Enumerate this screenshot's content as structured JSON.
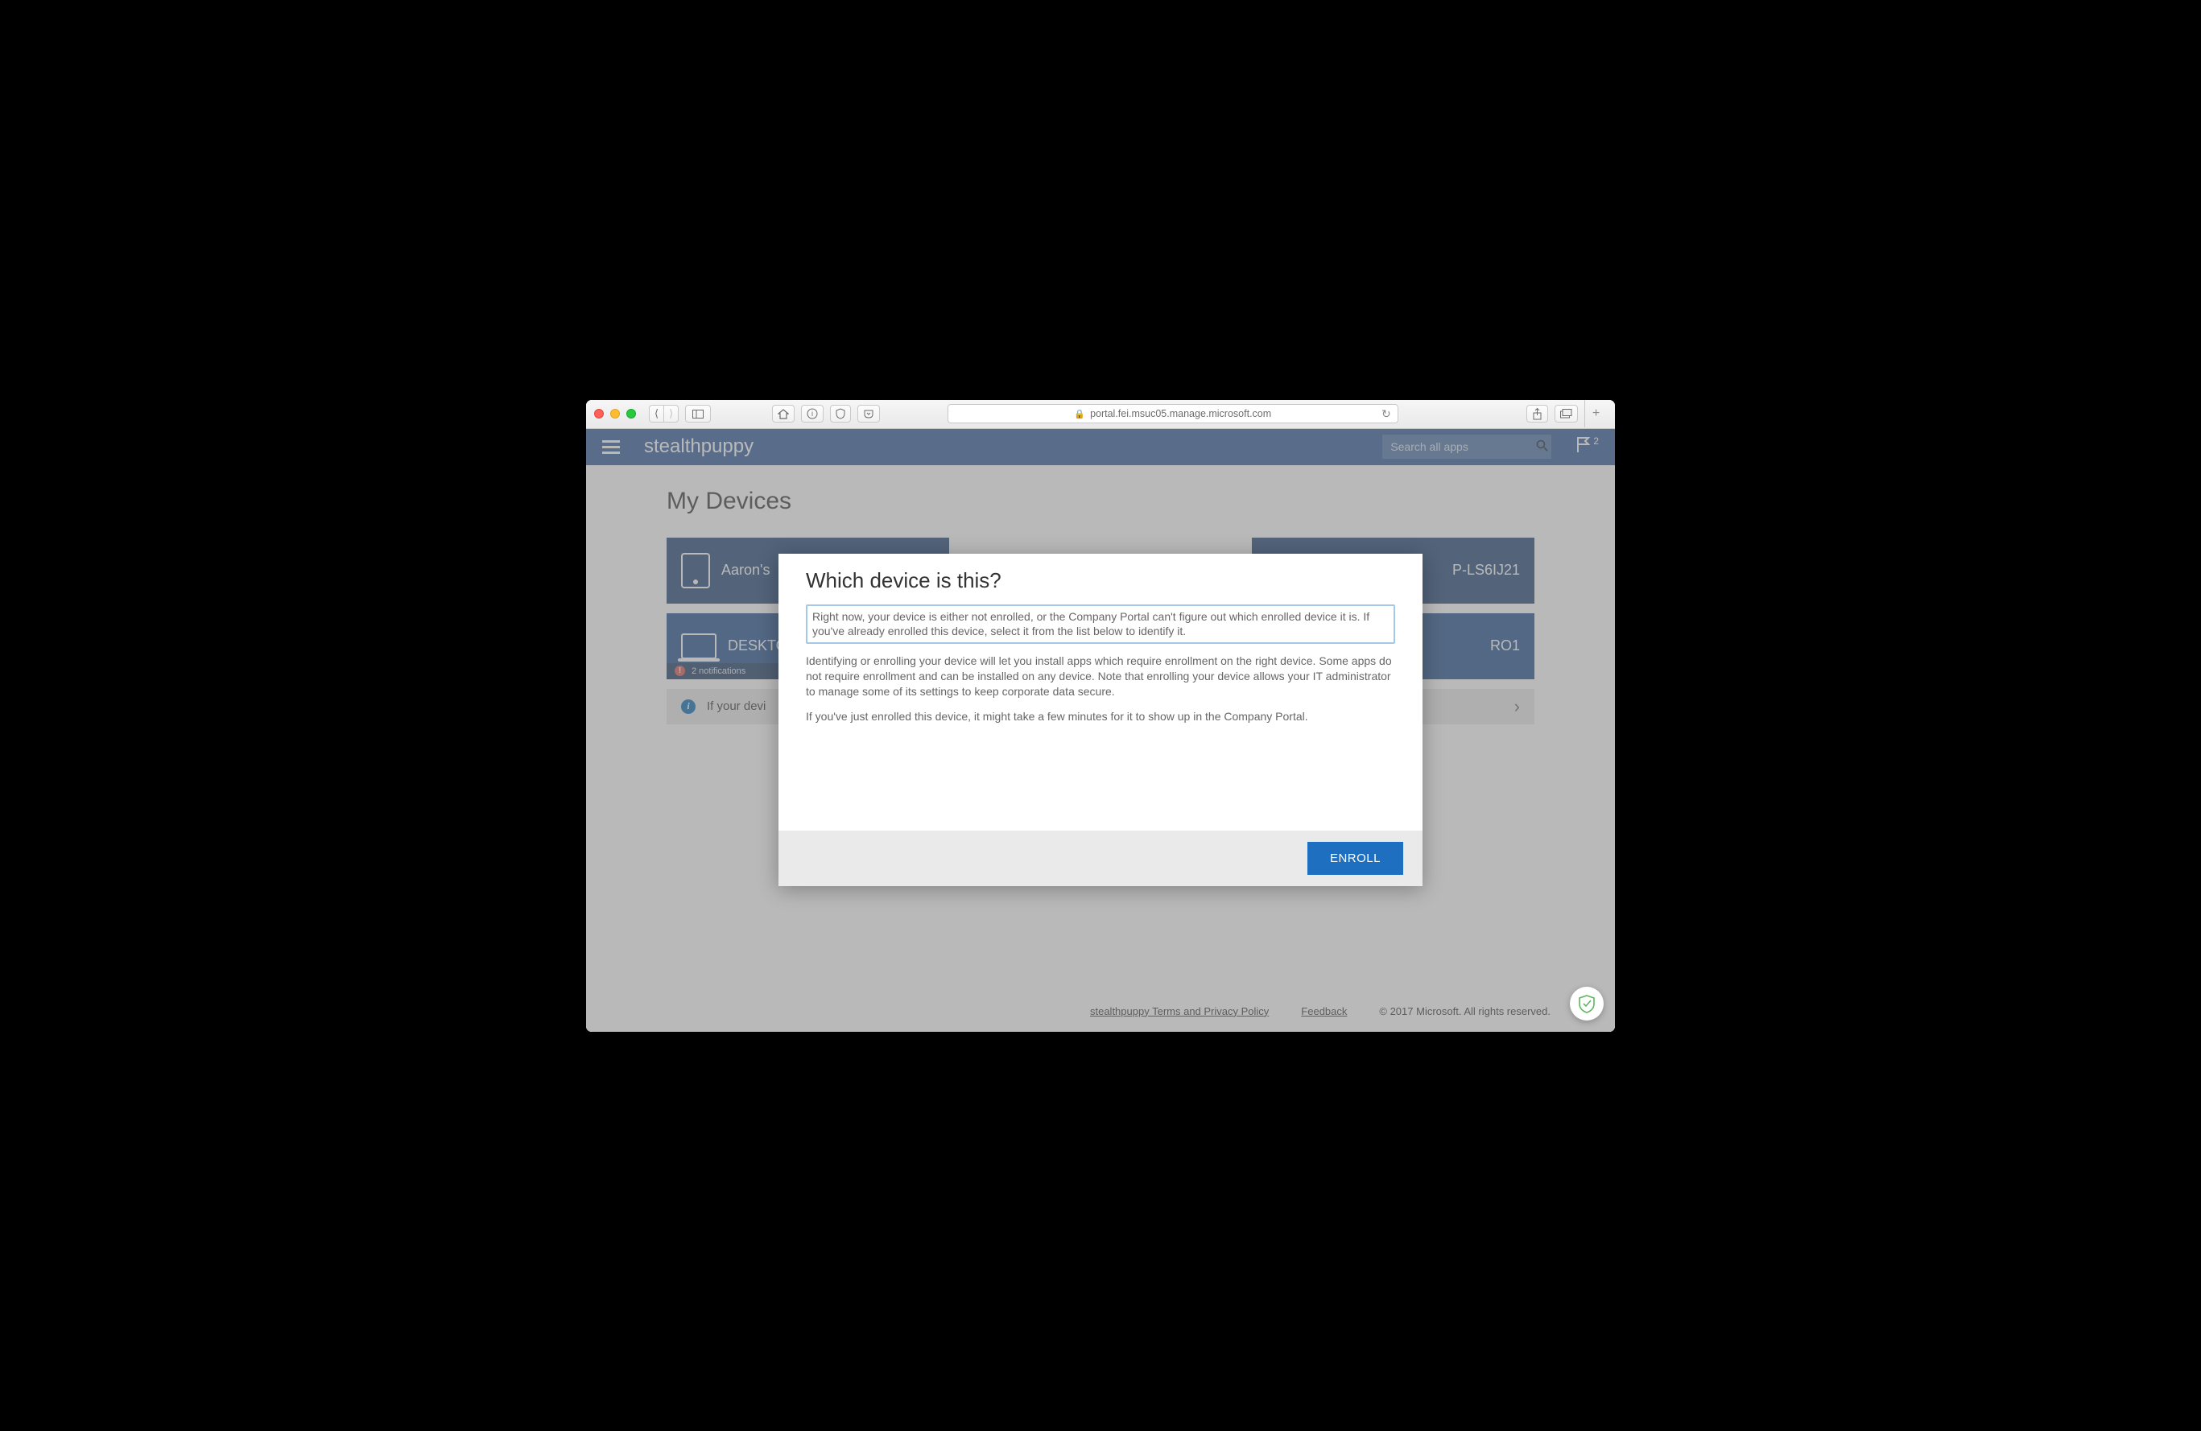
{
  "browser": {
    "url_display": "portal.fei.msuc05.manage.microsoft.com"
  },
  "header": {
    "brand": "stealthpuppy",
    "search_placeholder": "Search all apps",
    "notification_count": "2"
  },
  "page": {
    "title": "My Devices",
    "info_bar_text": "If your devi",
    "tiles": [
      {
        "label": "Aaron's",
        "notif_text": "2 notifications"
      },
      {
        "label": "DESKTO"
      },
      {
        "label_suffix": "P-LS6IJ21"
      },
      {
        "label_suffix": "RO1"
      }
    ]
  },
  "modal": {
    "title": "Which device is this?",
    "p1": "Right now, your device is either not enrolled, or the Company Portal can't figure out which enrolled device it is. If you've already enrolled this device, select it from the list below to identify it.",
    "p2": "Identifying or enrolling your device will let you install apps which require enrollment on the right device. Some apps do not require enrollment and can be installed on any device. Note that enrolling your device allows your IT administrator to manage some of its settings to keep corporate data secure.",
    "p3": "If you've just enrolled this device, it might take a few minutes for it to show up in the Company Portal.",
    "enroll_label": "ENROLL"
  },
  "footer": {
    "privacy": "stealthpuppy Terms and Privacy Policy",
    "feedback": "Feedback",
    "copyright": "© 2017 Microsoft. All rights reserved."
  }
}
